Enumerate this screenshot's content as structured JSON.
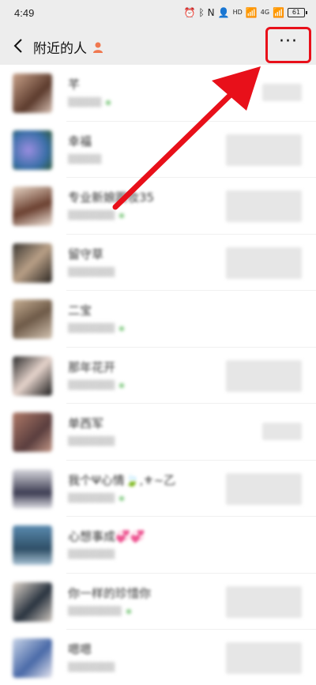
{
  "status_bar": {
    "time": "4:49",
    "icons": [
      "alarm-icon",
      "bluetooth-icon",
      "nfc-icon",
      "person-icon",
      "hd-signal-icon",
      "4g-signal-icon",
      "signal-icon",
      "battery-icon"
    ],
    "hd": "HD",
    "net": "4G",
    "battery": "61"
  },
  "nav": {
    "title": "附近的人",
    "more": "···"
  },
  "people": [
    {
      "name": "芊"
    },
    {
      "name": "幸福"
    },
    {
      "name": "专业新娘跟妆35"
    },
    {
      "name": "留守草"
    },
    {
      "name": "二宝"
    },
    {
      "name": "那年花开"
    },
    {
      "name": "单西军"
    },
    {
      "name": "我个Ψ心情🍃,⚜~乙"
    },
    {
      "name": "心想事成💞💞"
    },
    {
      "name": "你一样的珍惜你"
    },
    {
      "name": "嗯嗯"
    }
  ],
  "colors": {
    "highlight": "#e8101a",
    "header_bg": "#ededed"
  }
}
